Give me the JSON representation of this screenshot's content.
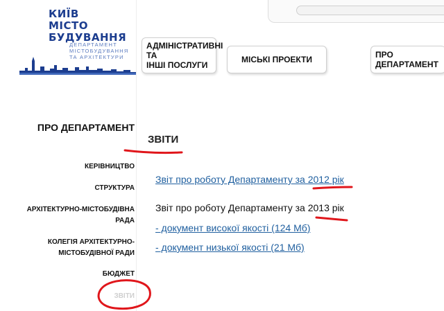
{
  "logo": {
    "big_lines": [
      "КИЇВ",
      "МІСТО",
      "БУДУВАННЯ"
    ],
    "small_lines": [
      "ДЕПАРТАМЕНТ",
      "МІСТОБУДУВАННЯ",
      "ТА АРХІТЕКТУРИ"
    ]
  },
  "search": {
    "value": "",
    "placeholder": ""
  },
  "nav": {
    "services_line1": "АДМІНІСТРАТИВНІ ТА",
    "services_line2": "ІНШІ ПОСЛУГИ",
    "projects": "МІСЬКІ ПРОЕКТИ",
    "about": "ПРО ДЕПАРТАМЕНТ"
  },
  "sidebar": {
    "title": "ПРО ДЕПАРТАМЕНТ",
    "items": [
      {
        "lines": [
          "КЕРІВНИЦТВО"
        ]
      },
      {
        "lines": [
          "СТРУКТУРА"
        ]
      },
      {
        "lines": [
          "АРХІТЕКТУРНО-МІСТОБУДІВНА",
          "РАДА"
        ]
      },
      {
        "lines": [
          "КОЛЕГІЯ АРХІТЕКТУРНО-",
          "МІСТОБУДІВНОЇ РАДИ"
        ]
      },
      {
        "lines": [
          "БЮДЖЕТ"
        ]
      },
      {
        "lines": [
          "ЗВІТИ"
        ]
      }
    ]
  },
  "main": {
    "title": "ЗВІТИ",
    "report_2012": "Звіт про роботу Департаменту за 2012 рік",
    "report_2013": "Звіт про роботу Департаменту за 2013 рік",
    "doc_high": "- документ високої якості (124 Мб)",
    "doc_low": "- документ низької якості (21 Мб)"
  },
  "colors": {
    "logo": "#1c3d8f",
    "link": "#1f5f9f",
    "annotation": "#e0161b",
    "muted": "#cfcfcf"
  }
}
